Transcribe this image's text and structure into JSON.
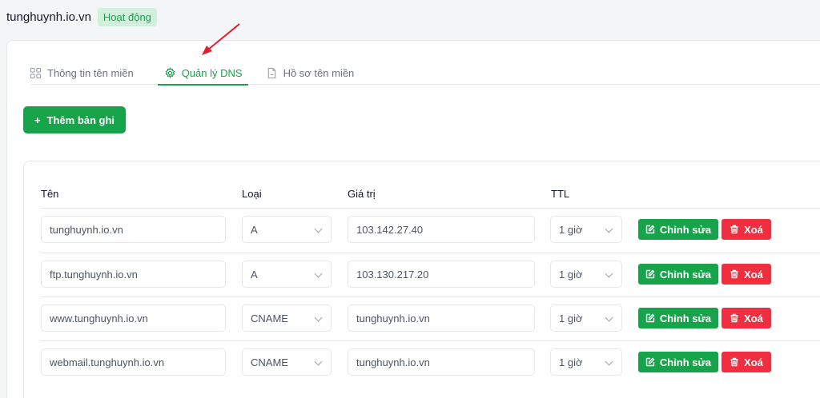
{
  "header": {
    "domain": "tunghuynh.io.vn",
    "status": "Hoạt động"
  },
  "tabs": [
    {
      "label": "Thông tin tên miền",
      "icon": "grid-icon"
    },
    {
      "label": "Quản lý DNS",
      "icon": "gear-icon",
      "active": true
    },
    {
      "label": "Hồ sơ tên miền",
      "icon": "file-icon"
    }
  ],
  "toolbar": {
    "add_label": "Thêm bản ghi"
  },
  "table": {
    "columns": [
      "Tên",
      "Loại",
      "Giá trị",
      "TTL"
    ],
    "rows": [
      {
        "name": "tunghuynh.io.vn",
        "type": "A",
        "value": "103.142.27.40",
        "ttl": "1 giờ"
      },
      {
        "name": "ftp.tunghuynh.io.vn",
        "type": "A",
        "value": "103.130.217.20",
        "ttl": "1 giờ"
      },
      {
        "name": "www.tunghuynh.io.vn",
        "type": "CNAME",
        "value": "tunghuynh.io.vn",
        "ttl": "1 giờ"
      },
      {
        "name": "webmail.tunghuynh.io.vn",
        "type": "CNAME",
        "value": "tunghuynh.io.vn",
        "ttl": "1 giờ"
      }
    ],
    "edit_label": "Chỉnh sửa",
    "delete_label": "Xoá"
  },
  "colors": {
    "accent": "#16a34a",
    "danger": "#ef2f3f",
    "annotation": "#e11d2e"
  }
}
